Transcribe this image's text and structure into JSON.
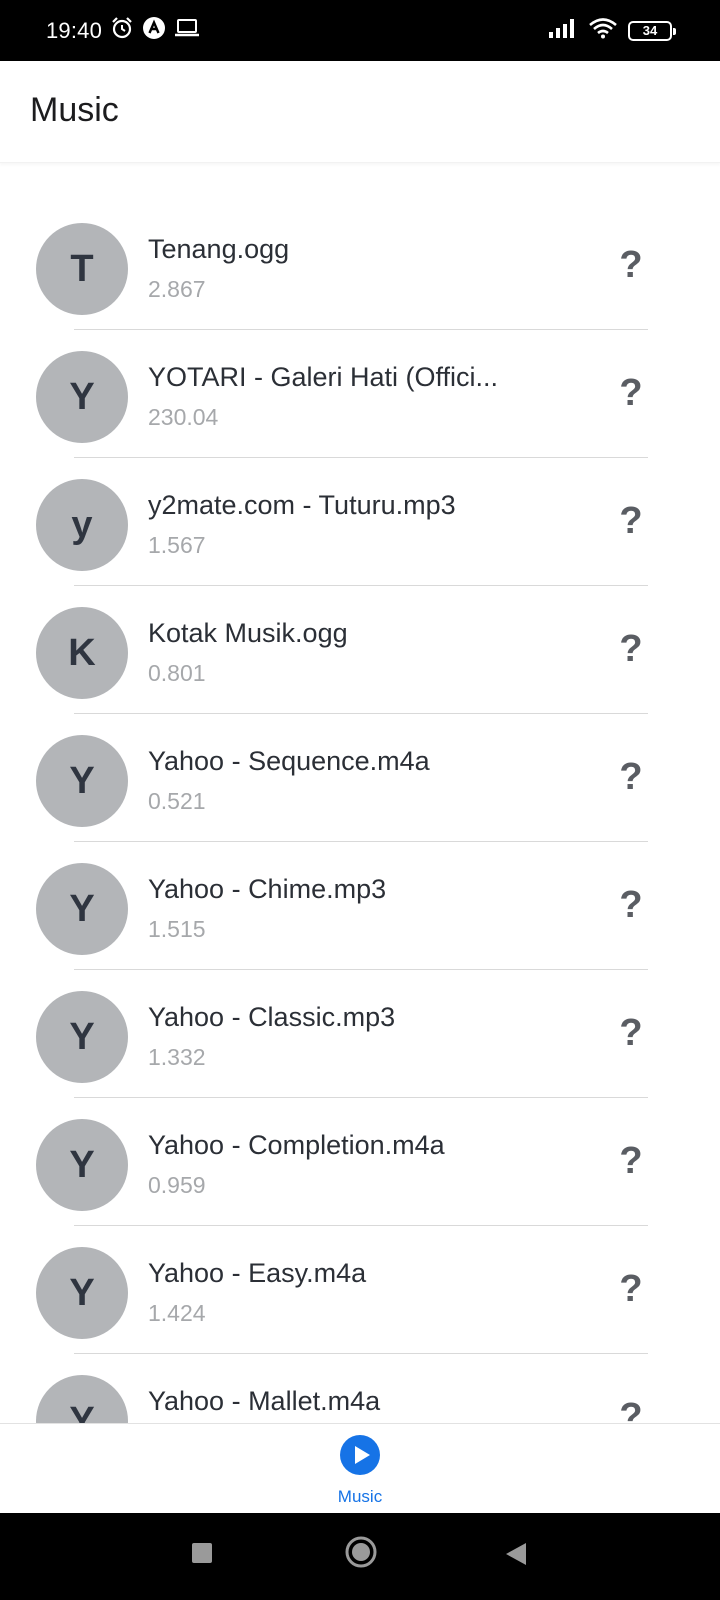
{
  "status_bar": {
    "time": "19:40",
    "battery": "34",
    "icons": [
      "alarm-icon",
      "a-app-icon",
      "laptop-icon",
      "signal-icon",
      "wifi-icon",
      "battery-icon"
    ]
  },
  "header": {
    "title": "Music"
  },
  "items": [
    {
      "initial": "T",
      "title": "Tenang.ogg",
      "subtitle": "2.867"
    },
    {
      "initial": "Y",
      "title": "YOTARI - Galeri Hati (Offici...",
      "subtitle": "230.04"
    },
    {
      "initial": "y",
      "title": "y2mate.com - Tuturu.mp3",
      "subtitle": "1.567"
    },
    {
      "initial": "K",
      "title": "Kotak Musik.ogg",
      "subtitle": "0.801"
    },
    {
      "initial": "Y",
      "title": "Yahoo - Sequence.m4a",
      "subtitle": "0.521"
    },
    {
      "initial": "Y",
      "title": "Yahoo - Chime.mp3",
      "subtitle": "1.515"
    },
    {
      "initial": "Y",
      "title": "Yahoo - Classic.mp3",
      "subtitle": "1.332"
    },
    {
      "initial": "Y",
      "title": "Yahoo - Completion.m4a",
      "subtitle": "0.959"
    },
    {
      "initial": "Y",
      "title": "Yahoo - Easy.m4a",
      "subtitle": "1.424"
    },
    {
      "initial": "Y",
      "title": "Yahoo - Mallet.m4a",
      "subtitle": ""
    }
  ],
  "item_action_icon": "help-icon",
  "bottom_nav": {
    "tabs": [
      {
        "label": "Music",
        "icon": "play-circle-icon",
        "active": true
      }
    ]
  },
  "colors": {
    "accent": "#1673e6",
    "avatar_bg": "#b3b5b8",
    "avatar_text": "#2f3540",
    "subtitle": "#a6a8ab"
  }
}
